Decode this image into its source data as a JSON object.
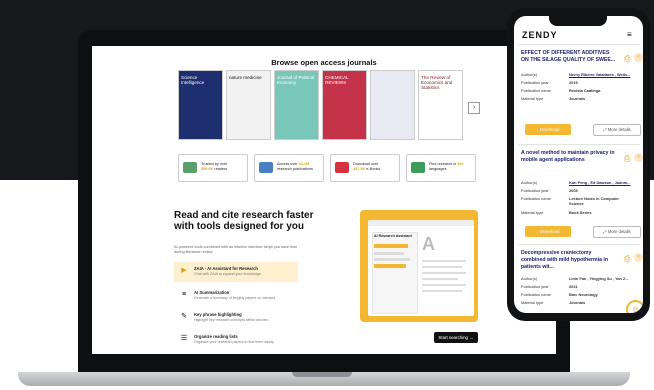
{
  "web": {
    "section_title": "Browse open access journals",
    "journals": [
      {
        "title": "Science Intelligence",
        "bg": "#1e2f70",
        "fg": "#ffffff"
      },
      {
        "title": "nature medicine",
        "bg": "#f2f2f2",
        "fg": "#111111"
      },
      {
        "title": "Journal of Political Economy",
        "bg": "#79c7b8",
        "fg": "#ffffff"
      },
      {
        "title": "CHEMICAL REVIEWS",
        "bg": "#c4334a",
        "fg": "#ffffff"
      },
      {
        "title": "",
        "bg": "#e7eaf3",
        "fg": "#333333"
      },
      {
        "title": "The Review of Economics and Statistics",
        "bg": "#ffffff",
        "fg": "#7a1a24"
      }
    ],
    "next_arrow": "›",
    "stats": [
      {
        "line1": "Trusted by over",
        "line2_pre": "",
        "line2_hl": "550.9K",
        "line2_post": " readers",
        "color": "#5aa06b"
      },
      {
        "line1": "Access over ",
        "line1_hl": "31.1M",
        "line2_pre": "research publications",
        "line2_hl": "",
        "line2_post": "",
        "color": "#4a7fc2"
      },
      {
        "line1": "Download over",
        "line2_pre": "",
        "line2_hl": "457.5K",
        "line2_post": " e-Books",
        "color": "#d9323f"
      },
      {
        "line1": "Find research in ",
        "line1_hl": "54+",
        "line2_pre": "languages",
        "line2_hl": "",
        "line2_post": "",
        "color": "#3c9c5a"
      }
    ],
    "cite_title": "Read and cite research faster with tools designed for you",
    "cite_sub": "AI-powered tools combined with an intuitive interface helps you save time during literature review.",
    "features": [
      {
        "title": "ZAIA - AI Assistant for Research",
        "desc": "Chat with ZAIA to expand your knowledge.",
        "icon": "▶"
      },
      {
        "title": "AI Summarization",
        "desc": "Generate a summary of lengthy papers on demand.",
        "icon": "≡"
      },
      {
        "title": "Key phrase highlighting",
        "desc": "Highlight key research concepts within articles.",
        "icon": "✎"
      },
      {
        "title": "Organize reading lists",
        "desc": "Organize your research papers to find them easily.",
        "icon": "☰"
      }
    ],
    "ai_panel_title": "AI Research Assistant",
    "start_button": "Start searching →"
  },
  "phone": {
    "logo": "ZENDY",
    "menu_icon": "≡",
    "results": [
      {
        "title": "EFFECT OF DIFFERENT ADDITIVES ON THE SILAGE QUALITY OF SWEE...",
        "authors": "Nerny Ribeiro Valadares , Wells...",
        "year": "2019",
        "publication": "Revista Caatinga",
        "material": "Journals"
      },
      {
        "title": "A novel method to maintain privacy in mobile agent applications",
        "authors": "Kun Peng , Ed Dawson , Juanm...",
        "year": "2005",
        "publication": "Lecture Notes in Computer Science",
        "material": "Book Series"
      },
      {
        "title": "Decompressive craniectomy combined with mild hypothermia in patients wit...",
        "authors": "Linin Fan , Yingying Su , Yan Z...",
        "year": "2021",
        "publication": "Bmc Neurology",
        "material": "Journals"
      }
    ],
    "labels": {
      "authors": "Author(s)",
      "year": "Publication year",
      "publication": "Publication name",
      "material": "Material type",
      "download": "↓ Download",
      "more": "⤢ More details"
    }
  },
  "colors": {
    "accent": "#f4b731",
    "navy": "#1a1d6b"
  }
}
